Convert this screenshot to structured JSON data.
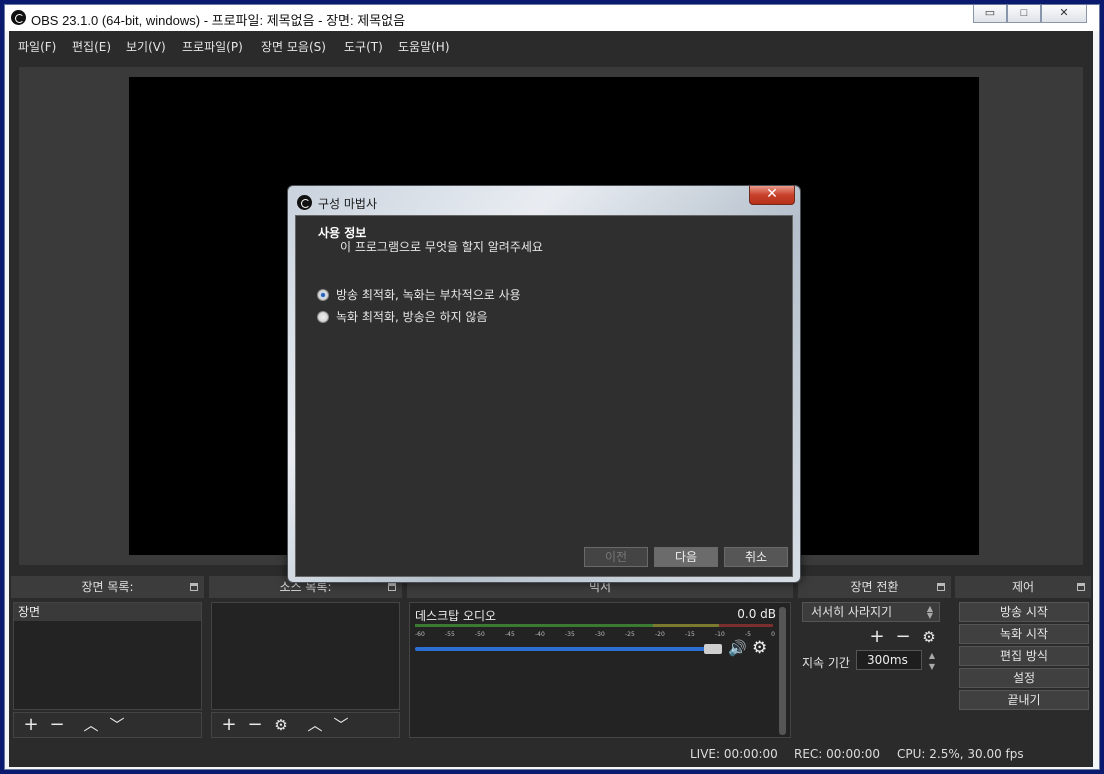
{
  "window": {
    "title": "OBS 23.1.0 (64-bit, windows) - 프로파일: 제목없음 - 장면: 제목없음",
    "controls": {
      "minimize": "▭",
      "maximize": "□",
      "close": "✕"
    }
  },
  "menu": [
    "파일(F)",
    "편집(E)",
    "보기(V)",
    "프로파일(P)",
    "장면 모음(S)",
    "도구(T)",
    "도움말(H)"
  ],
  "docks": {
    "scenes": {
      "title": "장면 목록:",
      "items": [
        "장면"
      ]
    },
    "sources": {
      "title": "소스 목록:"
    },
    "mixer": {
      "title": "믹서",
      "track_name": "데스크탑 오디오",
      "db": "0.0 dB",
      "ticks": [
        "-60",
        "-55",
        "-50",
        "-45",
        "-40",
        "-35",
        "-30",
        "-25",
        "-20",
        "-15",
        "-10",
        "-5",
        "0"
      ],
      "volume_level": 0.96
    },
    "transitions": {
      "title": "장면 전환",
      "selected": "서서히 사라지기",
      "duration_label": "지속 기간",
      "duration_value": "300ms"
    },
    "controls": {
      "title": "제어",
      "buttons": [
        "방송 시작",
        "녹화 시작",
        "편집 방식",
        "설정",
        "끝내기"
      ]
    }
  },
  "status": {
    "live": "LIVE: 00:00:00",
    "rec": "REC: 00:00:00",
    "cpu": "CPU: 2.5%, 30.00 fps"
  },
  "dialog": {
    "title": "구성 마법사",
    "close": "✕",
    "heading": "사용 정보",
    "subheading": "이 프로그램으로 무엇을 할지 알려주세요",
    "options": [
      {
        "label": "방송 최적화, 녹화는 부차적으로 사용",
        "checked": true
      },
      {
        "label": "녹화 최적화, 방송은 하지 않음",
        "checked": false
      }
    ],
    "buttons": {
      "back": "이전",
      "next": "다음",
      "cancel": "취소"
    }
  },
  "icons": {
    "add": "+",
    "remove": "−",
    "up": "︿",
    "down": "﹀",
    "gear": "⚙",
    "speaker": "🔊"
  },
  "colors": {
    "background": "#2b2b2b",
    "accent": "#2c6fd0",
    "dialog_frame": "#c9d2dd"
  }
}
